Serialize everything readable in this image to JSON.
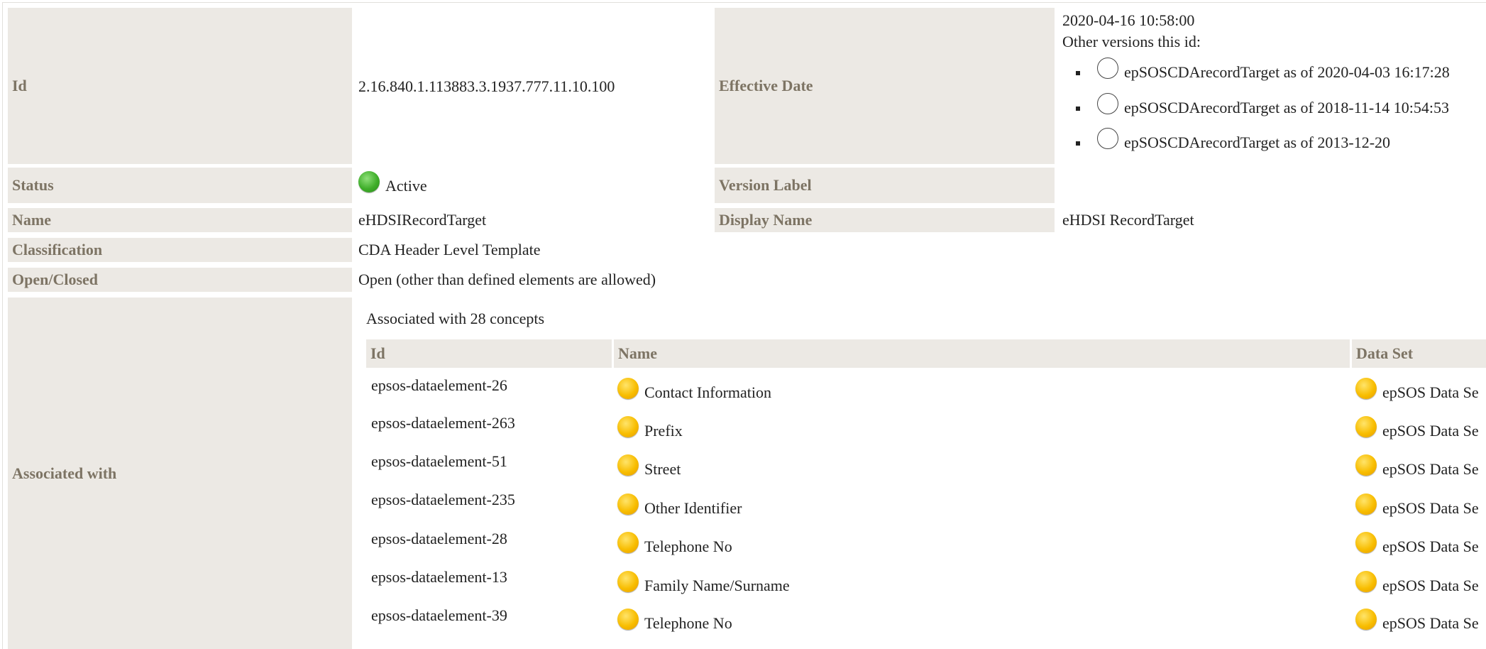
{
  "fields": {
    "id_label": "Id",
    "id_value": "2.16.840.1.113883.3.1937.777.11.10.100",
    "effective_date_label": "Effective Date",
    "effective_date_value": "2020-04-16 10:58:00",
    "other_versions_label": "Other versions this id:",
    "other_versions": [
      "epSOSCDArecordTarget as of 2020-04-03 16:17:28",
      "epSOSCDArecordTarget as of 2018-11-14 10:54:53",
      "epSOSCDArecordTarget as of 2013-12-20"
    ],
    "status_label": "Status",
    "status_value": "Active",
    "version_label_label": "Version Label",
    "version_label_value": "",
    "name_label": "Name",
    "name_value": "eHDSIRecordTarget",
    "display_name_label": "Display Name",
    "display_name_value": "eHDSI RecordTarget",
    "classification_label": "Classification",
    "classification_value": "CDA Header Level Template",
    "open_closed_label": "Open/Closed",
    "open_closed_value": "Open (other than defined elements are allowed)",
    "associated_with_label": "Associated with"
  },
  "colors": {
    "label_bg": "#ece9e4",
    "label_text": "#7d7464",
    "status_active": "#3fae2a",
    "concept_dot": "#f8bd00"
  },
  "concepts": {
    "summary": "Associated with 28 concepts",
    "headers": [
      "Id",
      "Name",
      "Data Set"
    ],
    "rows": [
      {
        "id": "epsos-dataelement-26",
        "name": "Contact Information",
        "dataset": "epSOS Data Se"
      },
      {
        "id": "epsos-dataelement-263",
        "name": "Prefix",
        "dataset": "epSOS Data Se"
      },
      {
        "id": "epsos-dataelement-51",
        "name": "Street",
        "dataset": "epSOS Data Se"
      },
      {
        "id": "epsos-dataelement-235",
        "name": "Other Identifier",
        "dataset": "epSOS Data Se"
      },
      {
        "id": "epsos-dataelement-28",
        "name": "Telephone No",
        "dataset": "epSOS Data Se"
      },
      {
        "id": "epsos-dataelement-13",
        "name": "Family Name/Surname",
        "dataset": "epSOS Data Se"
      },
      {
        "id": "epsos-dataelement-39",
        "name": "Telephone No",
        "dataset": "epSOS Data Se"
      }
    ]
  }
}
